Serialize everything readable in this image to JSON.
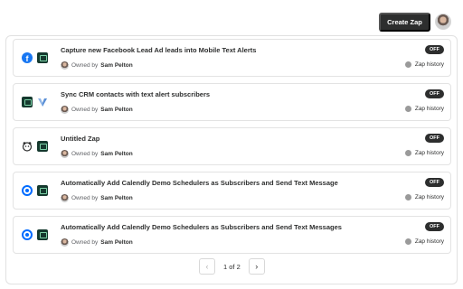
{
  "header": {
    "create_button_label": "Create Zap"
  },
  "zaps": [
    {
      "title": "Capture new Facebook Lead Ad leads into Mobile Text Alerts",
      "apps": [
        "facebook-icon",
        "text-alerts-icon"
      ],
      "owner_prefix": "Owned by",
      "owner_name": "Sam Pelton",
      "status": "OFF",
      "history_label": "Zap history"
    },
    {
      "title": "Sync CRM contacts with text alert subscribers",
      "apps": [
        "text-alerts-icon",
        "crm-icon"
      ],
      "owner_prefix": "Owned by",
      "owner_name": "Sam Pelton",
      "status": "OFF",
      "history_label": "Zap history"
    },
    {
      "title": "Untitled Zap",
      "apps": [
        "mailchimp-icon",
        "text-alerts-icon"
      ],
      "owner_prefix": "Owned by",
      "owner_name": "Sam Pelton",
      "status": "OFF",
      "history_label": "Zap history"
    },
    {
      "title": "Automatically Add Calendly Demo Schedulers as Subscribers and Send Text Message",
      "apps": [
        "calendly-icon",
        "text-alerts-icon"
      ],
      "owner_prefix": "Owned by",
      "owner_name": "Sam Pelton",
      "status": "OFF",
      "history_label": "Zap history"
    },
    {
      "title": "Automatically Add Calendly Demo Schedulers as Subscribers and Send Text Messages",
      "apps": [
        "calendly-icon",
        "text-alerts-icon"
      ],
      "owner_prefix": "Owned by",
      "owner_name": "Sam Pelton",
      "status": "OFF",
      "history_label": "Zap history"
    }
  ],
  "pagination": {
    "text": "1 of 2",
    "prev_icon": "chevron-left-icon",
    "next_icon": "chevron-right-icon"
  },
  "colors": {
    "primary_dark": "#2d2e2e",
    "facebook": "#1877f2",
    "calendly": "#006bff",
    "text_alerts": "#15392e"
  }
}
